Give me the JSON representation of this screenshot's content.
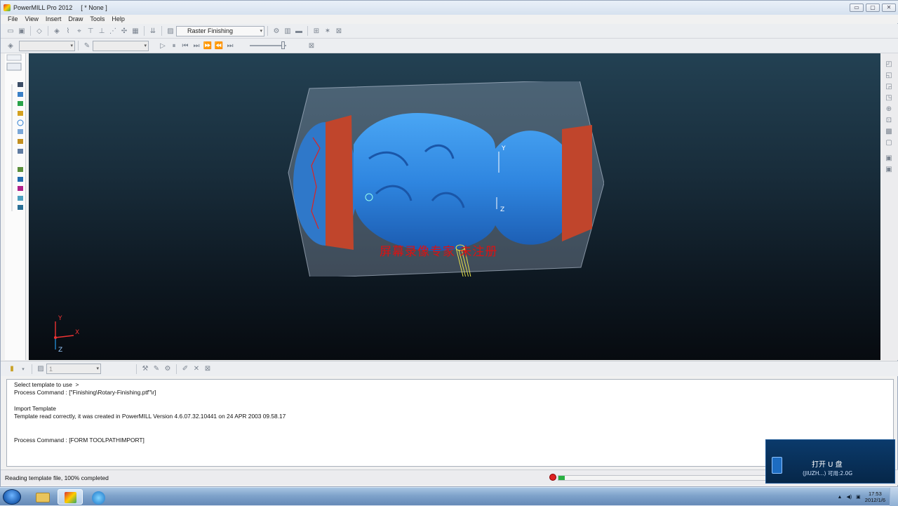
{
  "window": {
    "app_title": "PowerMILL Pro 2012",
    "document_title": "[ * None ]",
    "minimize": "▭",
    "maximize": "▢",
    "close": "✕"
  },
  "menu": [
    "File",
    "View",
    "Insert",
    "Draw",
    "Tools",
    "Help"
  ],
  "toolbar": {
    "strategy_combo": "Raster Finishing",
    "toolpath_combo": "",
    "tool_combo": "",
    "icons": [
      "open-icon",
      "save-icon",
      "tool-icon",
      "block-icon",
      "feeds-icon",
      "leads-icon",
      "start-point-icon",
      "end-point-icon",
      "boundary-icon",
      "pattern-icon",
      "toolpath-icon",
      "calc-icon"
    ]
  },
  "viewport": {
    "axis_y": "Y",
    "axis_x": "X",
    "axis_z": "Z",
    "model_axis_y": "Y",
    "model_axis_z": "Z",
    "watermark": "屏幕录像专家  未注册",
    "colors": {
      "model": "#2f86e0",
      "stock_ends": "#c0452c",
      "tool": "#e7e14a"
    }
  },
  "bottom_toolbar": {
    "combo_value": "1"
  },
  "output": {
    "lines": [
      "Select template to use  >",
      "Process Command : [\"Finishing\\Rotary-Finishing.ptf\"\\r]",
      "",
      "Import Template",
      "Template read correctly, it was created in PowerMILL Version 4.6.07.32.10441 on 24 APR 2003 09.58.17",
      "",
      "",
      "Process Command : [FORM TOOLPATHIMPORT]"
    ]
  },
  "status": {
    "text": "Reading template file, 100% completed",
    "progress_percent": 3
  },
  "usb_popup": {
    "title": "打开 U 盘",
    "subtitle": "(JIUZH...)  可用:2.0G"
  },
  "taskbar": {
    "time": "17:53",
    "date": "2012/1/6"
  }
}
